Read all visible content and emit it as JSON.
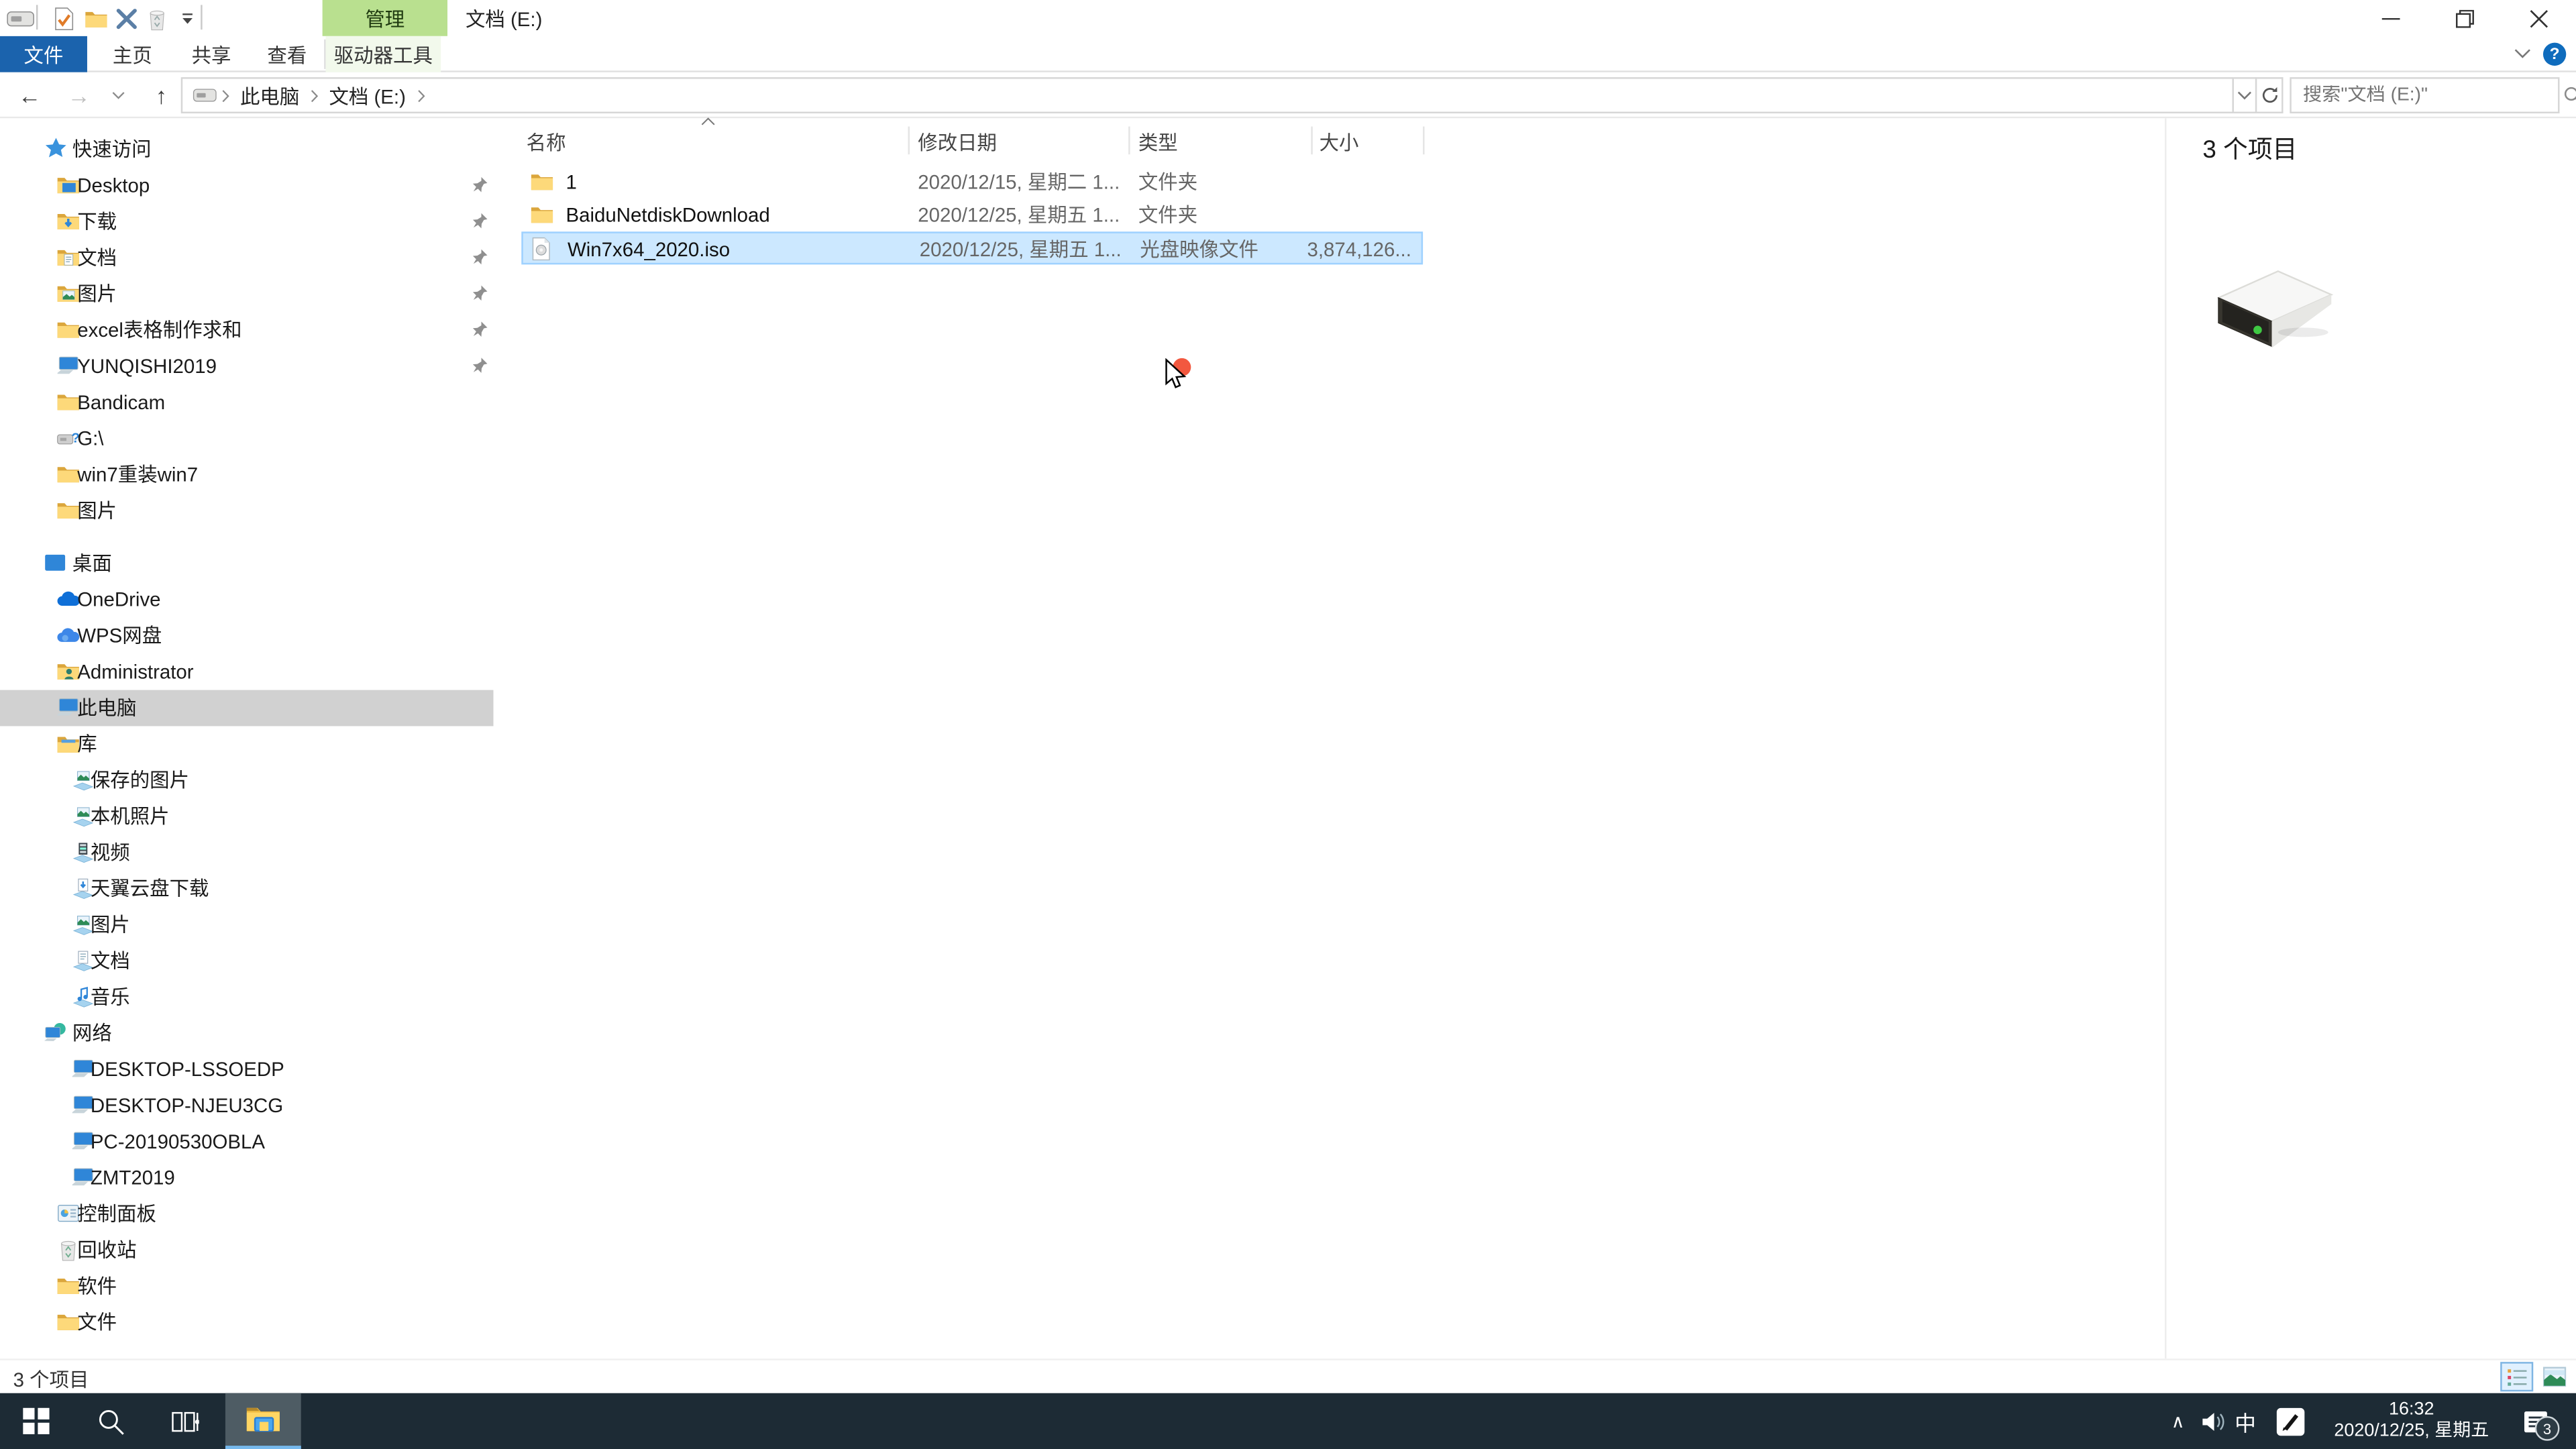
{
  "window": {
    "title": "文档 (E:)",
    "qat_icons": [
      "explorer-window-icon",
      "properties-check-icon",
      "new-folder-icon",
      "delete-x-icon",
      "recycle-bin-icon",
      "qat-dropdown-icon"
    ],
    "controls": {
      "minimize": "—",
      "restore": "restore",
      "close": "×"
    }
  },
  "ribbon": {
    "tabs": [
      {
        "label": "文件",
        "active": true
      },
      {
        "label": "主页",
        "active": false
      },
      {
        "label": "共享",
        "active": false
      },
      {
        "label": "查看",
        "active": false
      }
    ],
    "contextual": {
      "header": "管理",
      "tab": "驱动器工具"
    },
    "help_label": "?"
  },
  "nav": {
    "breadcrumb": [
      "此电脑",
      "文档 (E:)"
    ],
    "search_placeholder": "搜索\"文档 (E:)\""
  },
  "sidebar": {
    "items": [
      {
        "label": "快速访问",
        "icon": "star",
        "level": 0,
        "pinned": false,
        "selected": false,
        "gap": false
      },
      {
        "label": "Desktop",
        "icon": "folder-desktop",
        "level": 1,
        "pinned": true,
        "selected": false,
        "gap": false
      },
      {
        "label": "下载",
        "icon": "folder-download",
        "level": 1,
        "pinned": true,
        "selected": false,
        "gap": false
      },
      {
        "label": "文档",
        "icon": "folder-doc",
        "level": 1,
        "pinned": true,
        "selected": false,
        "gap": false
      },
      {
        "label": "图片",
        "icon": "folder-pic",
        "level": 1,
        "pinned": true,
        "selected": false,
        "gap": false
      },
      {
        "label": "excel表格制作求和",
        "icon": "folder",
        "level": 1,
        "pinned": true,
        "selected": false,
        "gap": false
      },
      {
        "label": "YUNQISHI2019",
        "icon": "pc",
        "level": 1,
        "pinned": true,
        "selected": false,
        "gap": false
      },
      {
        "label": "Bandicam",
        "icon": "folder",
        "level": 1,
        "pinned": false,
        "selected": false,
        "gap": false
      },
      {
        "label": "G:\\",
        "icon": "usb",
        "level": 1,
        "pinned": false,
        "selected": false,
        "gap": false
      },
      {
        "label": "win7重装win7",
        "icon": "folder",
        "level": 1,
        "pinned": false,
        "selected": false,
        "gap": false
      },
      {
        "label": "图片",
        "icon": "folder",
        "level": 1,
        "pinned": false,
        "selected": false,
        "gap": false
      },
      {
        "label": "桌面",
        "icon": "desktop-blue",
        "level": 0,
        "pinned": false,
        "selected": false,
        "gap": true
      },
      {
        "label": "OneDrive",
        "icon": "onedrive",
        "level": 1,
        "pinned": false,
        "selected": false,
        "gap": false
      },
      {
        "label": "WPS网盘",
        "icon": "wps-cloud",
        "level": 1,
        "pinned": false,
        "selected": false,
        "gap": false
      },
      {
        "label": "Administrator",
        "icon": "folder-user",
        "level": 1,
        "pinned": false,
        "selected": false,
        "gap": false
      },
      {
        "label": "此电脑",
        "icon": "pc",
        "level": 1,
        "pinned": false,
        "selected": true,
        "gap": false
      },
      {
        "label": "库",
        "icon": "library",
        "level": 1,
        "pinned": false,
        "selected": false,
        "gap": false
      },
      {
        "label": "保存的图片",
        "icon": "lib-pic",
        "level": 2,
        "pinned": false,
        "selected": false,
        "gap": false
      },
      {
        "label": "本机照片",
        "icon": "lib-pic",
        "level": 2,
        "pinned": false,
        "selected": false,
        "gap": false
      },
      {
        "label": "视频",
        "icon": "lib-video",
        "level": 2,
        "pinned": false,
        "selected": false,
        "gap": false
      },
      {
        "label": "天翼云盘下载",
        "icon": "lib-download",
        "level": 2,
        "pinned": false,
        "selected": false,
        "gap": false
      },
      {
        "label": "图片",
        "icon": "lib-pic",
        "level": 2,
        "pinned": false,
        "selected": false,
        "gap": false
      },
      {
        "label": "文档",
        "icon": "lib-doc",
        "level": 2,
        "pinned": false,
        "selected": false,
        "gap": false
      },
      {
        "label": "音乐",
        "icon": "lib-music",
        "level": 2,
        "pinned": false,
        "selected": false,
        "gap": false
      },
      {
        "label": "网络",
        "icon": "network",
        "level": 0,
        "pinned": false,
        "selected": false,
        "gap": false
      },
      {
        "label": "DESKTOP-LSSOEDP",
        "icon": "pc",
        "level": 2,
        "pinned": false,
        "selected": false,
        "gap": false
      },
      {
        "label": "DESKTOP-NJEU3CG",
        "icon": "pc",
        "level": 2,
        "pinned": false,
        "selected": false,
        "gap": false
      },
      {
        "label": "PC-20190530OBLA",
        "icon": "pc",
        "level": 2,
        "pinned": false,
        "selected": false,
        "gap": false
      },
      {
        "label": "ZMT2019",
        "icon": "pc",
        "level": 2,
        "pinned": false,
        "selected": false,
        "gap": false
      },
      {
        "label": "控制面板",
        "icon": "control-panel",
        "level": 1,
        "pinned": false,
        "selected": false,
        "gap": false
      },
      {
        "label": "回收站",
        "icon": "recycle",
        "level": 1,
        "pinned": false,
        "selected": false,
        "gap": false
      },
      {
        "label": "软件",
        "icon": "folder",
        "level": 1,
        "pinned": false,
        "selected": false,
        "gap": false
      },
      {
        "label": "文件",
        "icon": "folder",
        "level": 1,
        "pinned": false,
        "selected": false,
        "gap": false
      }
    ]
  },
  "list": {
    "columns": [
      {
        "label": "名称",
        "sorted": "asc"
      },
      {
        "label": "修改日期",
        "sorted": ""
      },
      {
        "label": "类型",
        "sorted": ""
      },
      {
        "label": "大小",
        "sorted": ""
      }
    ],
    "rows": [
      {
        "icon": "folder",
        "name": "1",
        "date": "2020/12/15, 星期二 1...",
        "type": "文件夹",
        "size": "",
        "selected": false
      },
      {
        "icon": "folder",
        "name": "BaiduNetdiskDownload",
        "date": "2020/12/25, 星期五 1...",
        "type": "文件夹",
        "size": "",
        "selected": false
      },
      {
        "icon": "iso-file",
        "name": "Win7x64_2020.iso",
        "date": "2020/12/25, 星期五 1...",
        "type": "光盘映像文件",
        "size": "3,874,126...",
        "selected": true
      }
    ]
  },
  "preview": {
    "count_label": "3 个项目",
    "icon": "drive-3d"
  },
  "statusbar": {
    "count_label": "3 个项目"
  },
  "taskbar": {
    "tray": {
      "chevron": "∧",
      "ime_lang": "中",
      "time": "16:32",
      "date": "2020/12/25, 星期五",
      "action_badge": "3"
    }
  },
  "colors": {
    "selection_blue": "#cce8ff",
    "manage_tab_green": "#b9e08f",
    "file_tab_blue": "#1b63ad",
    "taskbar_bg": "#1d2b35",
    "taskbar_active": "#4e5c64",
    "taskbar_underline": "#76b9ed",
    "sidebar_selected": "#d1d1d1"
  }
}
